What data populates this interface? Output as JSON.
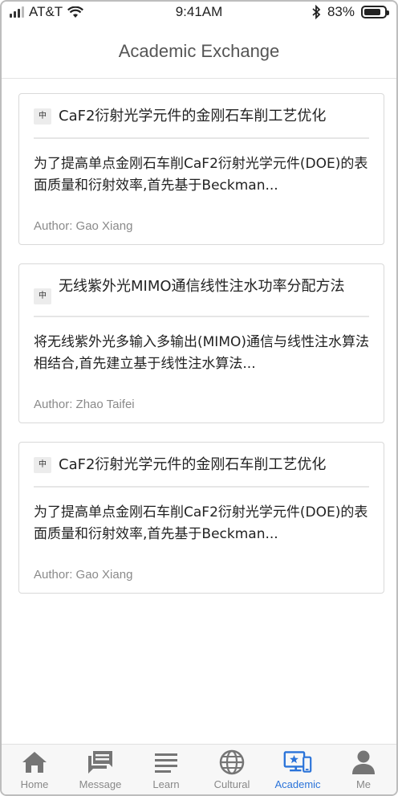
{
  "status": {
    "carrier": "AT&T",
    "time": "9:41AM",
    "battery": "83%",
    "battery_level": 0.83
  },
  "header": {
    "title": "Academic Exchange"
  },
  "papers": [
    {
      "lang": "中",
      "title": "CaF2衍射光学元件的金刚石车削工艺优化",
      "summary": "为了提高单点金刚石车削CaF2衍射光学元件(DOE)的表面质量和衍射效率,首先基于Beckman...",
      "author": "Author:  Gao Xiang"
    },
    {
      "lang": "中",
      "title": "无线紫外光MIMO通信线性注水功率分配方法",
      "summary": "将无线紫外光多输入多输出(MIMO)通信与线性注水算法相结合,首先建立基于线性注水算法...",
      "author": "Author:  Zhao Taifei"
    },
    {
      "lang": "中",
      "title": "CaF2衍射光学元件的金刚石车削工艺优化",
      "summary": "为了提高单点金刚石车削CaF2衍射光学元件(DOE)的表面质量和衍射效率,首先基于Beckman...",
      "author": "Author:  Gao Xiang"
    }
  ],
  "tabs": [
    {
      "label": "Home",
      "icon": "home-icon",
      "active": false
    },
    {
      "label": "Message",
      "icon": "message-icon",
      "active": false
    },
    {
      "label": "Learn",
      "icon": "list-icon",
      "active": false
    },
    {
      "label": "Cultural",
      "icon": "globe-icon",
      "active": false
    },
    {
      "label": "Academic",
      "icon": "academic-icon",
      "active": true
    },
    {
      "label": "Me",
      "icon": "person-icon",
      "active": false
    }
  ],
  "colors": {
    "accent": "#2a73d9",
    "inactive_icon": "#757575"
  }
}
